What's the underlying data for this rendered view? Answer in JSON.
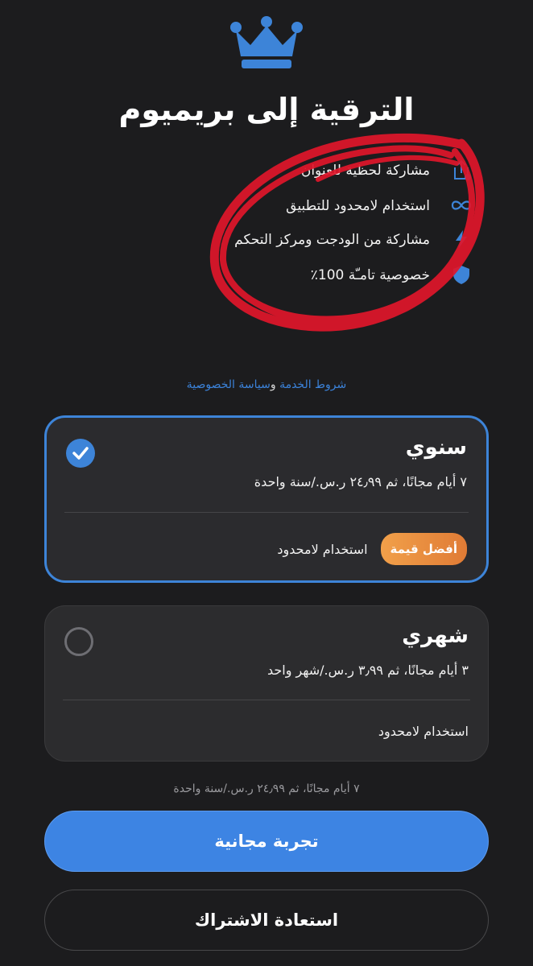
{
  "header": {
    "icon": "crown-icon",
    "title": "الترقية إلى بريميوم"
  },
  "features": [
    {
      "icon": "share-icon",
      "label": "مشاركة لحظية للعنوان"
    },
    {
      "icon": "infinity-icon",
      "label": "استخدام لامحدود للتطبيق"
    },
    {
      "icon": "bolt-icon",
      "label": "مشاركة من الودجت ومركز التحكم"
    },
    {
      "icon": "shield-icon",
      "label": "خصوصية تامـّة 100٪"
    }
  ],
  "legal": {
    "terms": "شروط الخدمة",
    "and": " و",
    "privacy": "سياسة الخصوصية"
  },
  "plans": [
    {
      "name": "سنوي",
      "price": "٧ أيام مجانًا، ثم ٢٤٫٩٩ ر.س./سنة واحدة",
      "feature": "استخدام لامحدود",
      "badge": "أفضل قيمة",
      "selected": true
    },
    {
      "name": "شهري",
      "price": "٣ أيام مجانًا، ثم ٣٫٩٩ ر.س./شهر واحد",
      "feature": "استخدام لامحدود",
      "selected": false
    }
  ],
  "summary": "٧ أيام مجانًا، ثم ٢٤٫٩٩ ر.س./سنة واحدة",
  "buttons": {
    "trial": "تجربة مجانية",
    "restore": "استعادة الاشتراك"
  },
  "colors": {
    "accent": "#3d84e3",
    "badge": "#e88a3f",
    "background": "#1c1c1e",
    "annotation": "#e0162b"
  }
}
